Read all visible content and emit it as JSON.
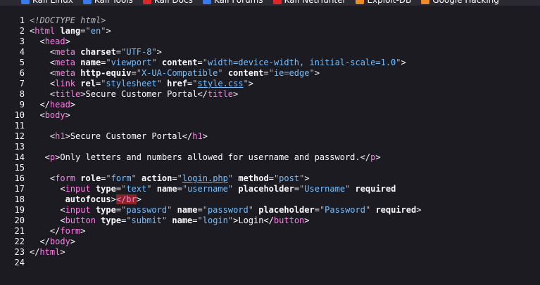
{
  "bookmarks": [
    {
      "label": "Kali Linux",
      "icon": "kali-icon",
      "color": "#367bf0"
    },
    {
      "label": "Kali Tools",
      "icon": "kali-icon",
      "color": "#367bf0"
    },
    {
      "label": "Kali Docs",
      "icon": "docs-icon",
      "color": "#e2252b"
    },
    {
      "label": "Kali Forums",
      "icon": "forums-icon",
      "color": "#367bf0"
    },
    {
      "label": "Kali NetHunter",
      "icon": "nethunter-icon",
      "color": "#e2252b"
    },
    {
      "label": "Exploit-DB",
      "icon": "exploit-icon",
      "color": "#f08a24"
    },
    {
      "label": "Google Hacking",
      "icon": "google-icon",
      "color": "#f08a24"
    }
  ],
  "source": {
    "line_numbers": [
      "1",
      "2",
      "3",
      "4",
      "5",
      "6",
      "7",
      "8",
      "9",
      "10",
      "11",
      "12",
      "13",
      "14",
      "15",
      "16",
      "17",
      "18",
      "19",
      "20",
      "21",
      "22",
      "23",
      "24"
    ],
    "l1_doctype": "<!DOCTYPE html>",
    "l2": {
      "tag": "html",
      "attr": "lang",
      "val": "en"
    },
    "l3_tag": "head",
    "l4": {
      "tag": "meta",
      "attr": "charset",
      "val": "UTF-8"
    },
    "l5": {
      "tag": "meta",
      "attr1": "name",
      "val1": "viewport",
      "attr2": "content",
      "val2": "width=device-width, initial-scale=1.0"
    },
    "l6": {
      "tag": "meta",
      "attr1": "http-equiv",
      "val1": "X-UA-Compatible",
      "attr2": "content",
      "val2": "ie=edge"
    },
    "l7": {
      "tag": "link",
      "attr1": "rel",
      "val1": "stylesheet",
      "attr2": "href",
      "val2": "style.css"
    },
    "l8": {
      "tag": "title",
      "text": "Secure Customer Portal"
    },
    "l9_tag": "head",
    "l10_tag": "body",
    "l12": {
      "tag": "h1",
      "text": "Secure Customer Portal"
    },
    "l14": {
      "tag": "p",
      "text": "Only letters and numbers allowed for username and password."
    },
    "l16": {
      "tag": "form",
      "attr1": "role",
      "val1": "form",
      "attr2": "action",
      "val2": "login.php",
      "attr3": "method",
      "val3": "post"
    },
    "l17": {
      "tag": "input",
      "attr1": "type",
      "val1": "text",
      "attr2": "name",
      "val2": "username",
      "attr3": "placeholder",
      "val3": "Username",
      "attr4": "required"
    },
    "l18": {
      "attr": "autofocus",
      "err_tag": "br"
    },
    "l19": {
      "tag": "input",
      "attr1": "type",
      "val1": "password",
      "attr2": "name",
      "val2": "password",
      "attr3": "placeholder",
      "val3": "Password",
      "attr4": "required"
    },
    "l20": {
      "tag": "button",
      "attr1": "type",
      "val1": "submit",
      "attr2": "name",
      "val2": "login",
      "text": "Login"
    },
    "l21_tag": "form",
    "l22_tag": "body",
    "l23_tag": "html"
  }
}
